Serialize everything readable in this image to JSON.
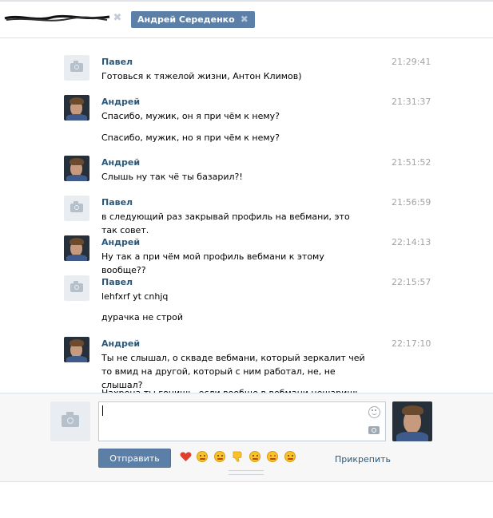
{
  "tabs": {
    "active_label": "Андрей Середенко"
  },
  "messages": [
    {
      "author": "Павел",
      "time": "21:29:41",
      "avatar": "camera-placeholder-icon",
      "lines": [
        "Готовься к тяжелой жизни, Антон Климов)"
      ]
    },
    {
      "author": "Андрей",
      "time": "21:31:37",
      "avatar": "user-photo",
      "lines": [
        "Спасибо, мужик, он я при чём к нему?",
        "Спасибо, мужик, но я при чём к нему?"
      ]
    },
    {
      "author": "Андрей",
      "time": "21:51:52",
      "avatar": "user-photo",
      "lines": [
        "Слышь ну так чё ты базарил?!"
      ]
    },
    {
      "author": "Павел",
      "time": "21:56:59",
      "avatar": "camera-placeholder-icon",
      "lines": [
        "в следующий раз закрывай профиль на вебмани, это так совет."
      ]
    },
    {
      "author": "Андрей",
      "time": "22:14:13",
      "avatar": "user-photo",
      "lines": [
        "Ну так а при чём мой профиль вебмани к этому вообще??"
      ]
    },
    {
      "author": "Павел",
      "time": "22:15:57",
      "avatar": "camera-placeholder-icon",
      "lines": [
        "lehfxrf yt cnhjq",
        "дурачка не строй"
      ]
    },
    {
      "author": "Андрей",
      "time": "22:17:10",
      "avatar": "user-photo",
      "lines": [
        "Ты не слышал, о скваде вебмани, который зеркалит чей то вмид на другой, который с ним работал, не, не слышал?",
        "Нахрена ты гонишь, если вообще в вебмани нешаришь"
      ]
    }
  ],
  "composer": {
    "input_value": "",
    "send_label": "Отправить",
    "attach_label": "Прикрепить",
    "emoji": [
      "heart-icon",
      "wink-emoji-icon",
      "relieved-emoji-icon",
      "thumbs-down-icon",
      "kiss-emoji-icon",
      "heart-eyes-emoji-icon",
      "smile-emoji-icon"
    ]
  },
  "colors": {
    "accent": "#5b7fa6",
    "author_link": "#2b587a",
    "timestamp": "#a3a3a3"
  }
}
